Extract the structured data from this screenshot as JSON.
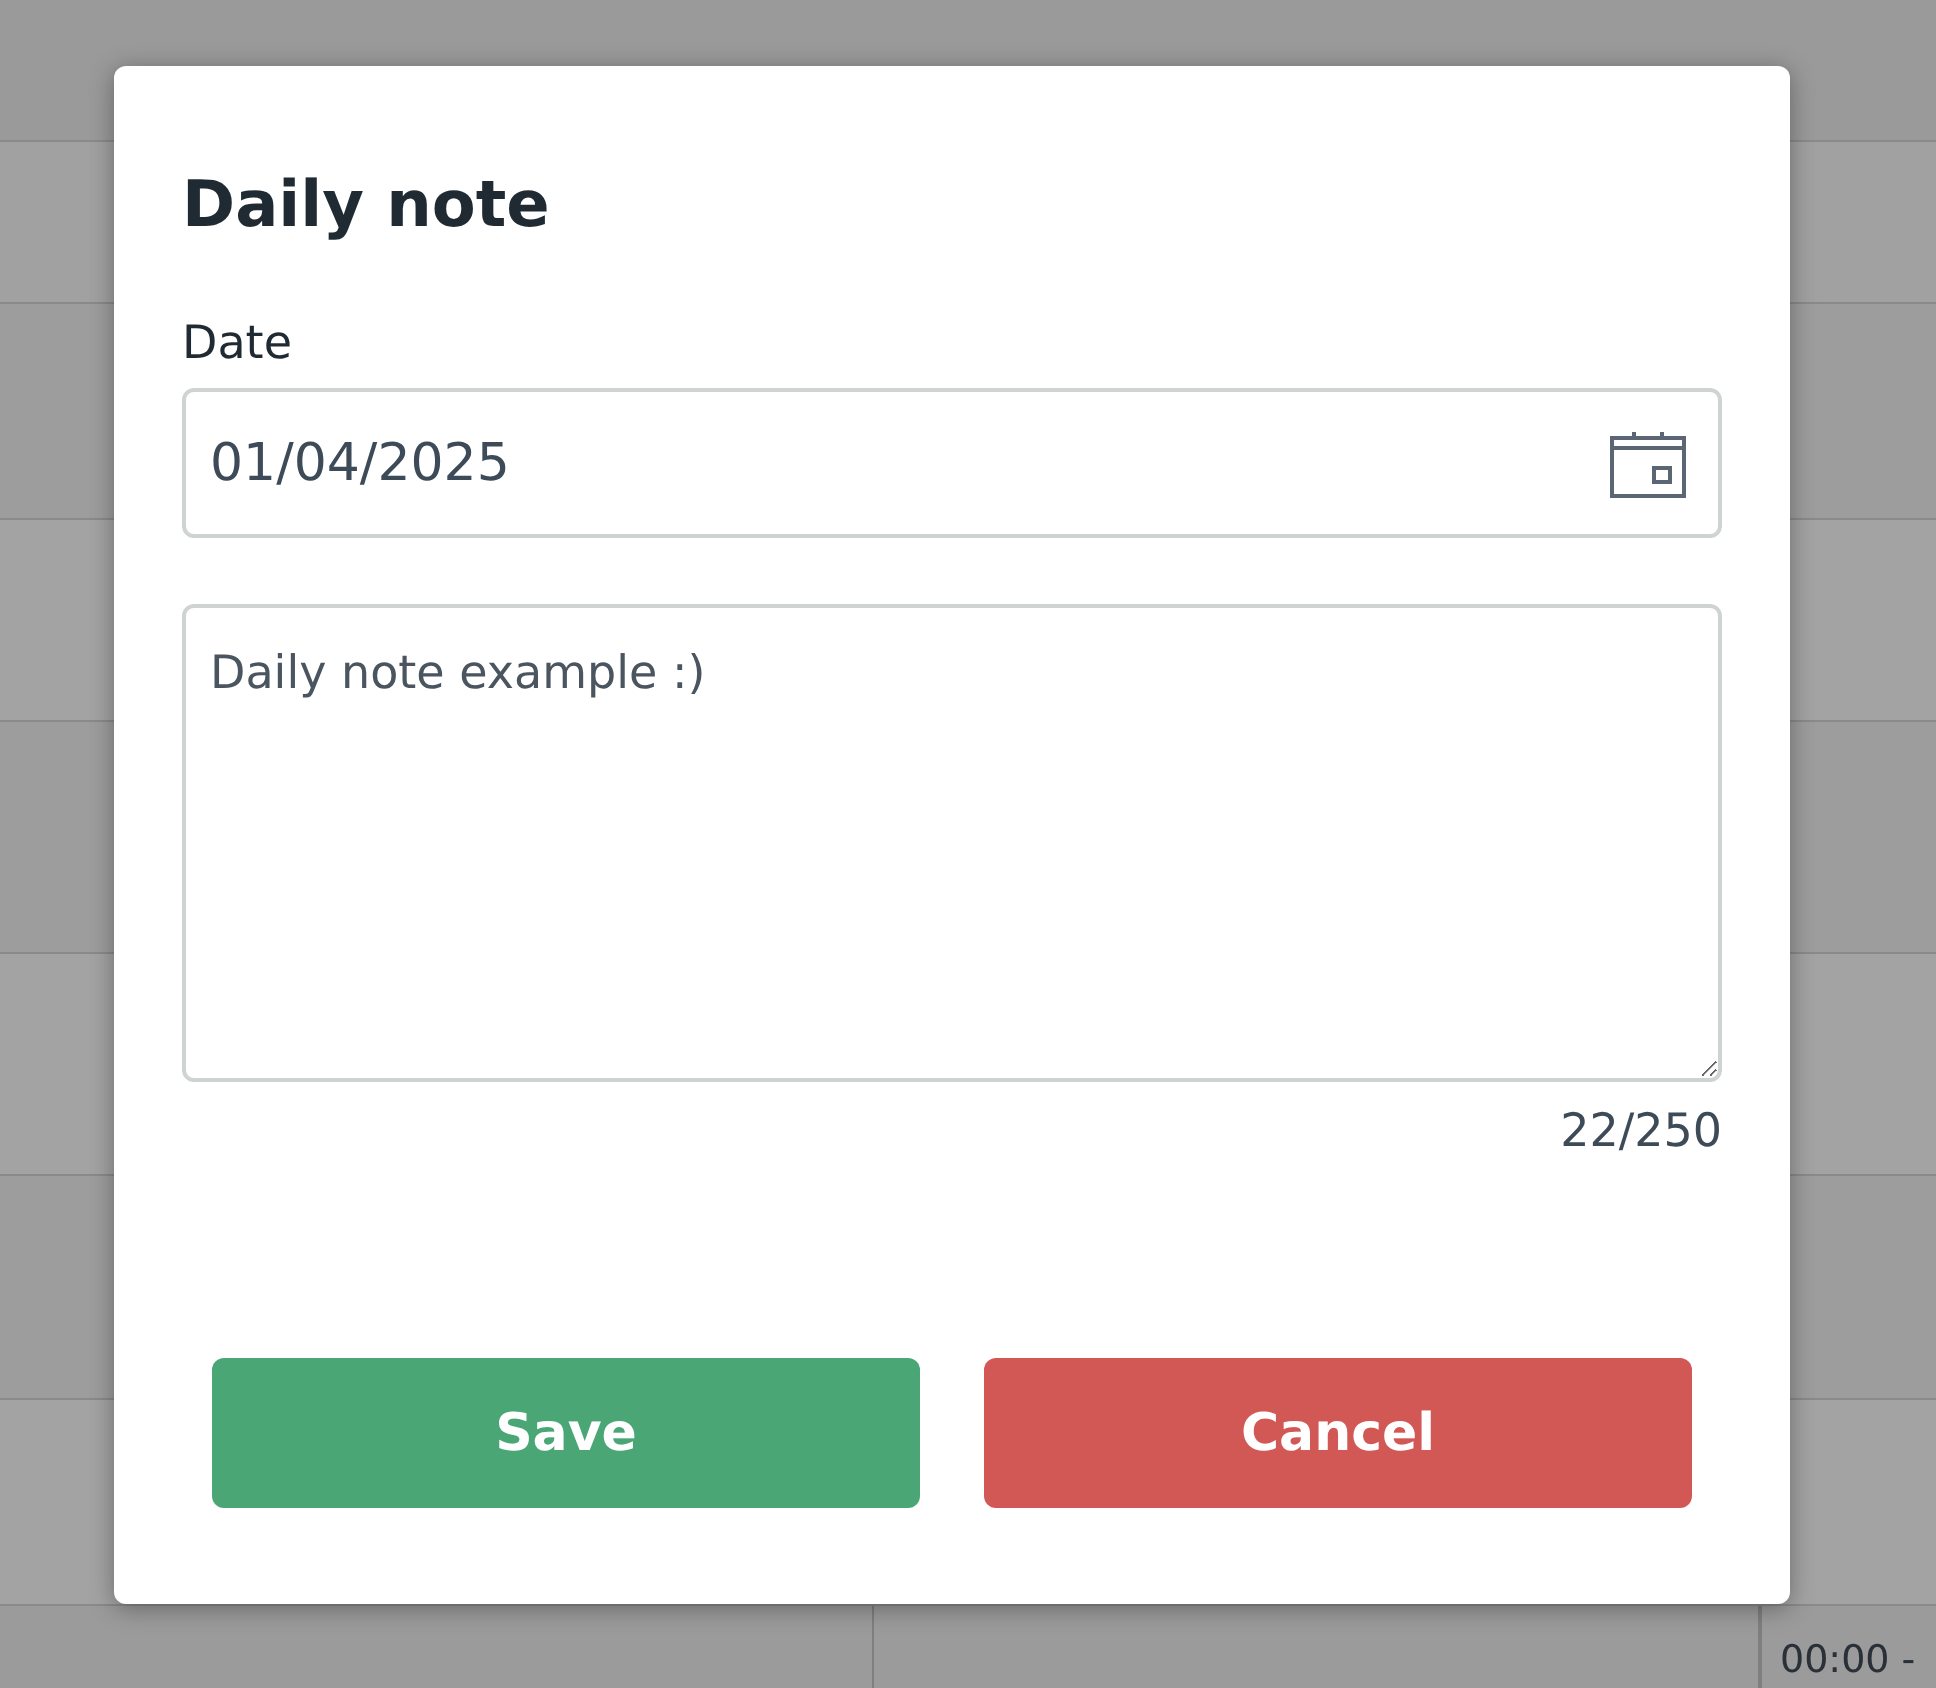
{
  "background": {
    "time_label": "00:00 -"
  },
  "dialog": {
    "title": "Daily note",
    "date_field": {
      "label": "Date",
      "value": "01/04/2025"
    },
    "note_field": {
      "value": "Daily note example :)"
    },
    "counter": "22/250",
    "buttons": [
      {
        "label": "Save",
        "kind": "primary"
      },
      {
        "label": "Cancel",
        "kind": "danger"
      }
    ]
  }
}
